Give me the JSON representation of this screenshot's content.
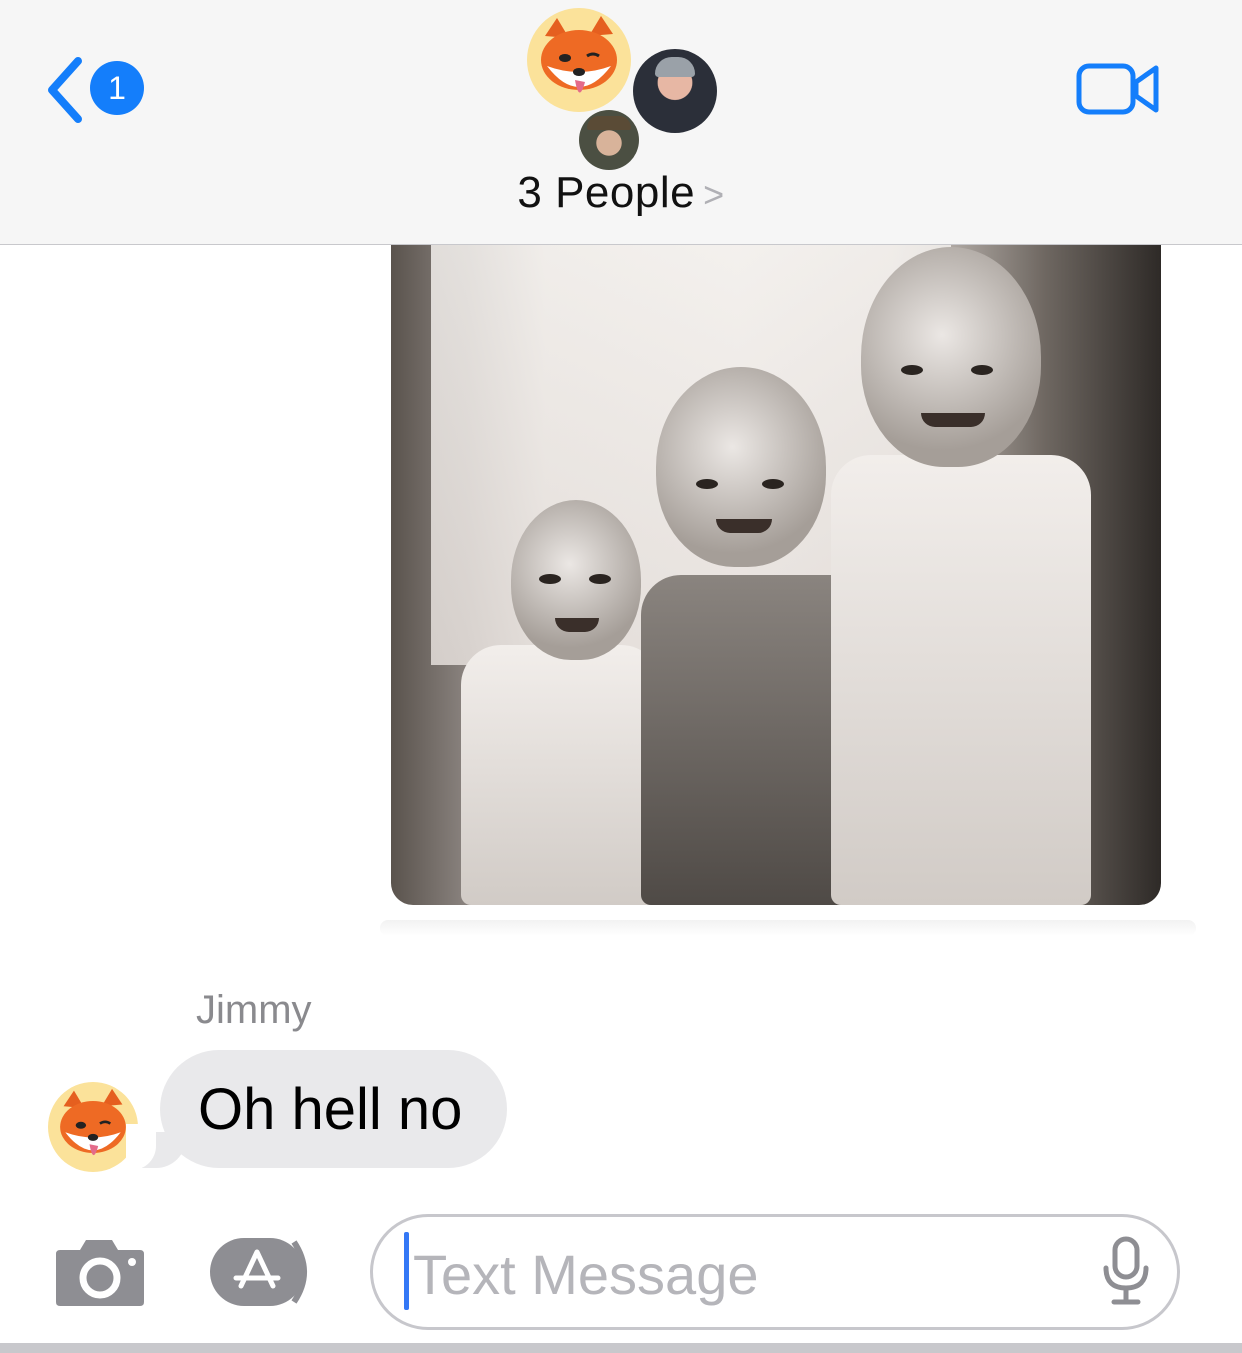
{
  "header": {
    "back_badge": "1",
    "group_name": "3 People",
    "group_chevron": ">",
    "icons": {
      "back": "chevron-left-icon",
      "video": "video-camera-icon"
    },
    "accent_color": "#147efb"
  },
  "messages": [
    {
      "type": "photo",
      "direction": "outgoing"
    },
    {
      "type": "text",
      "direction": "incoming",
      "sender": "Jimmy",
      "text": "Oh hell no"
    }
  ],
  "input_bar": {
    "placeholder": "Text Message",
    "icons": {
      "camera": "camera-icon",
      "apps": "app-store-icon",
      "mic": "microphone-icon"
    }
  }
}
